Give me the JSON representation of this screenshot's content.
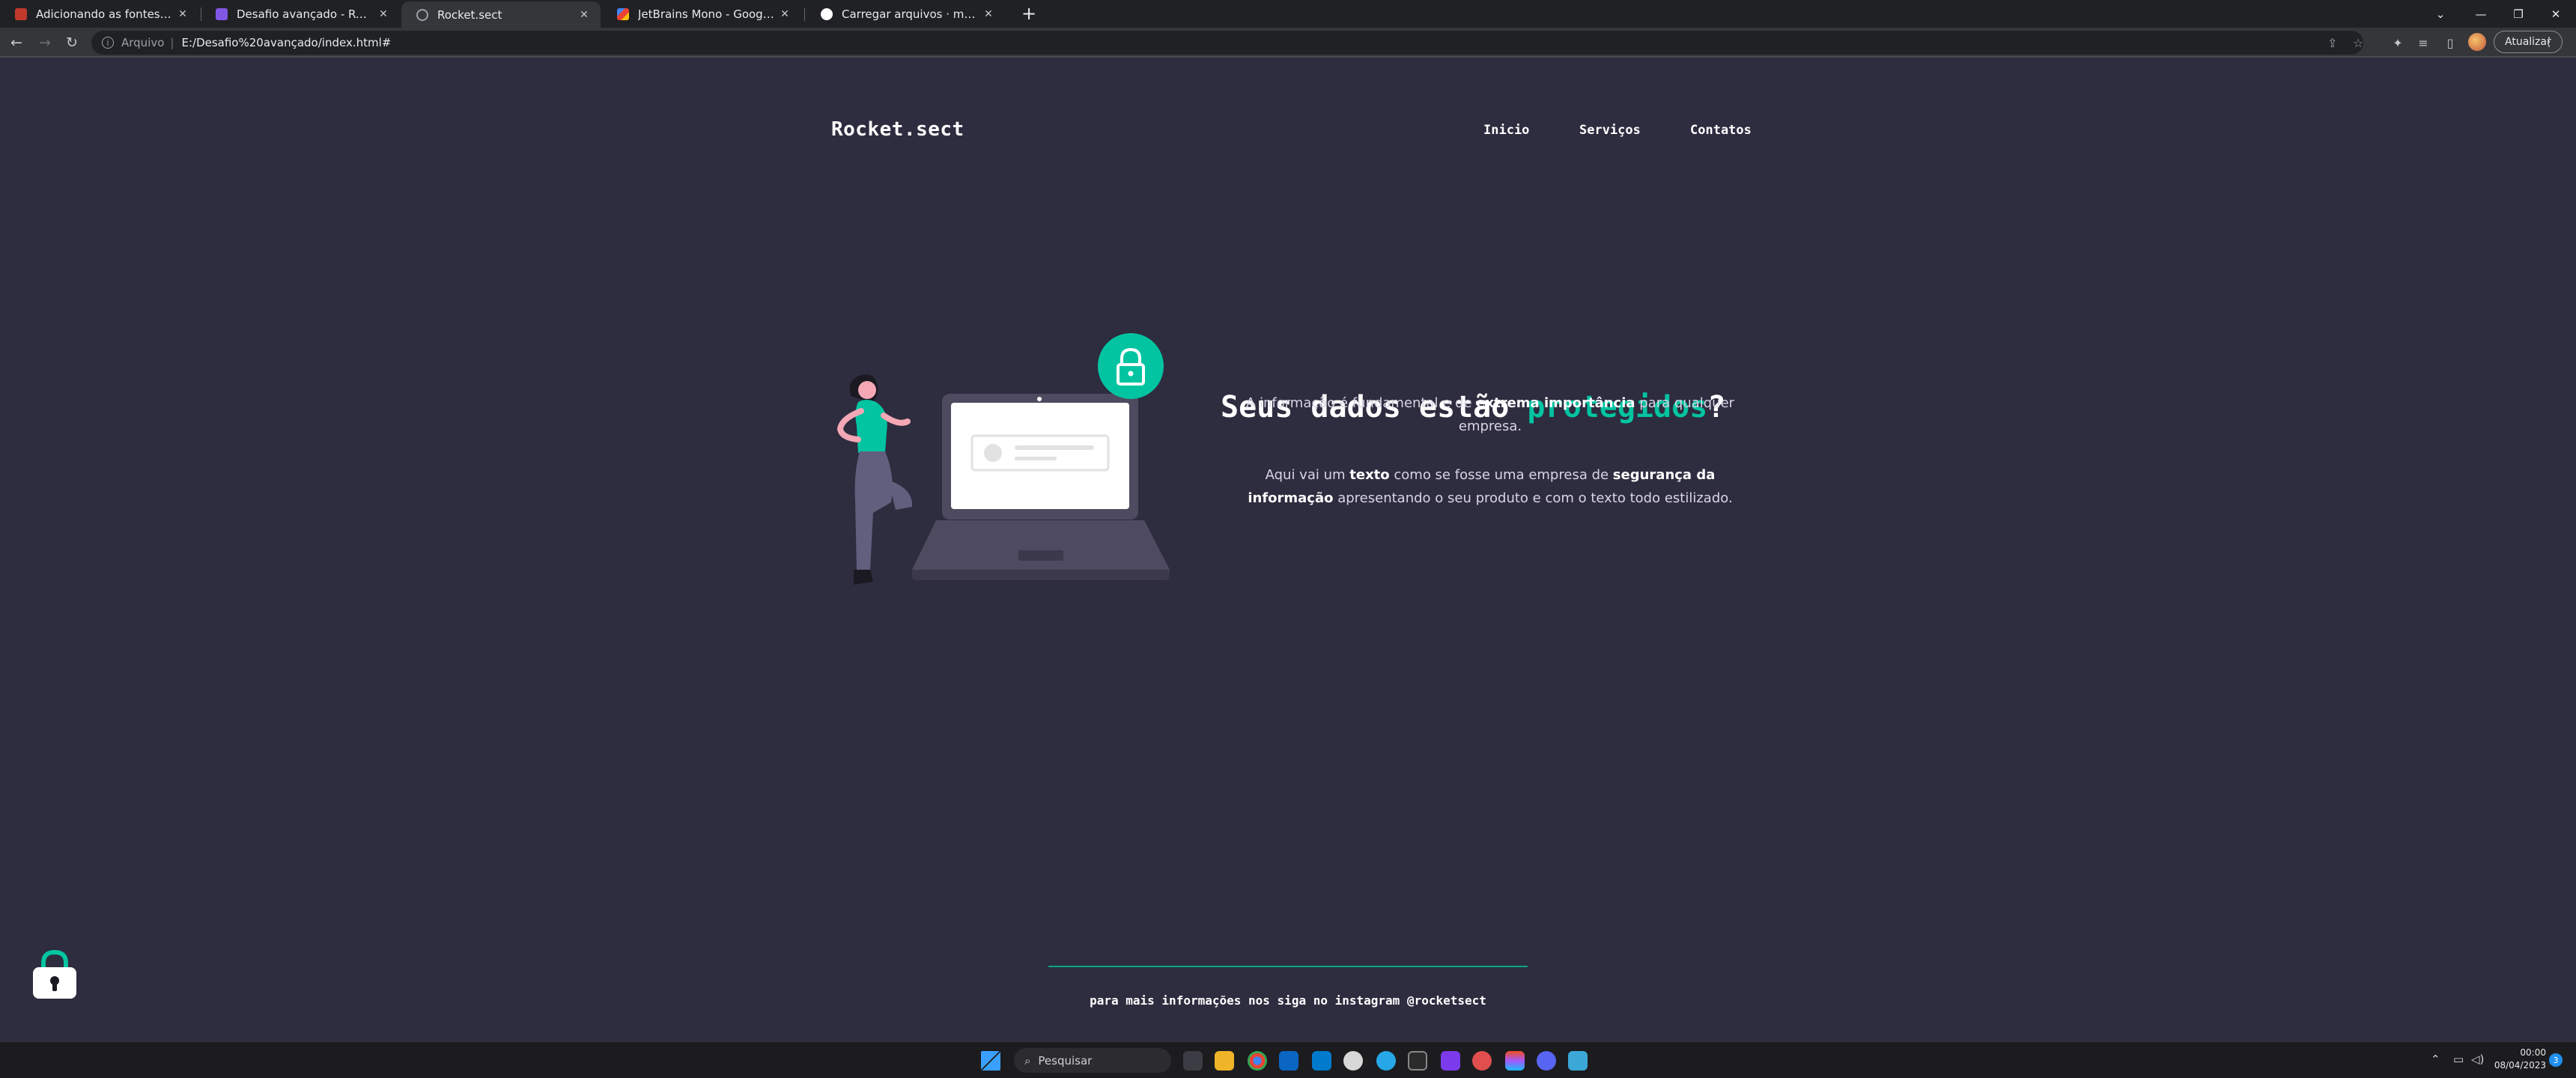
{
  "browser": {
    "tabs": [
      {
        "title": "Adicionando as fontes e melhorando",
        "favicon": "notion-icon",
        "favicon_color": "#c0392b"
      },
      {
        "title": "Desafio avançado - Recriando layo",
        "favicon": "rocket-icon",
        "favicon_color": "#8257e5"
      },
      {
        "title": "Rocket.sect",
        "favicon": "globe-icon",
        "favicon_color": "#9aa0a6",
        "active": true
      },
      {
        "title": "JetBrains Mono - Google Fonts",
        "favicon": "google-fonts-icon",
        "favicon_color": "#4285f4"
      },
      {
        "title": "Carregar arquivos · mrcrcode/De",
        "favicon": "github-icon",
        "favicon_color": "#ffffff"
      }
    ],
    "new_tab_glyph": "+",
    "address": {
      "scheme_label": "Arquivo",
      "separator": "|",
      "url": "E:/Desafio%20avançado/index.html#"
    },
    "update_button_label": "Atualizar"
  },
  "site": {
    "logo": "Rocket.sect",
    "nav": [
      "Inicio",
      "Serviços",
      "Contatos"
    ],
    "hero": {
      "title_prefix": "Seus dados estão ",
      "title_accent": "protegidos",
      "title_suffix": "?",
      "p1_a": "A informação é fundamental e de ",
      "p1_bold": "extrema importância",
      "p1_b": " para qualquer empresa.",
      "p2_a": "Aqui vai um ",
      "p2_bold": "texto",
      "p2_b": " como se fosse uma empresa de ",
      "p2_accent": "segurança da informação",
      "p2_c": " apresentando o seu produto e com o texto todo estilizado."
    },
    "footer_text": "para mais informações nos siga no instagram @rocketsect",
    "accent_color": "#02c4a1",
    "background_color": "#2e2c3f"
  },
  "taskbar": {
    "search_placeholder": "Pesquisar",
    "clock_time": "00:00",
    "clock_date": "08/04/2023",
    "notification_count": "3"
  }
}
